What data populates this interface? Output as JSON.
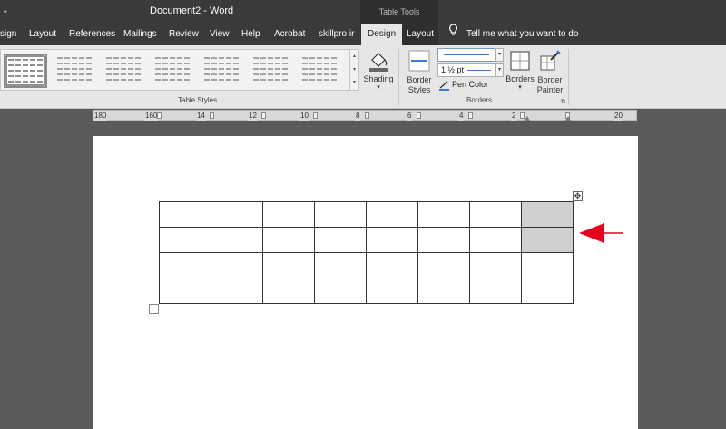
{
  "window": {
    "title": "Document2  -  Word",
    "context_header": "Table Tools",
    "qat_glyph": "⇣"
  },
  "tabs": [
    {
      "id": "design-doc",
      "label": "sign"
    },
    {
      "id": "layout",
      "label": "Layout"
    },
    {
      "id": "references",
      "label": "References"
    },
    {
      "id": "mailings",
      "label": "Mailings"
    },
    {
      "id": "review",
      "label": "Review"
    },
    {
      "id": "view",
      "label": "View"
    },
    {
      "id": "help",
      "label": "Help"
    },
    {
      "id": "acrobat",
      "label": "Acrobat"
    },
    {
      "id": "skillpro",
      "label": "skillpro.ir"
    },
    {
      "id": "table-design",
      "label": "Design",
      "active": true
    },
    {
      "id": "table-layout",
      "label": "Layout"
    }
  ],
  "tell_me": "Tell me what you want to do",
  "ribbon": {
    "table_styles_label": "Table Styles",
    "shading_label": "Shading",
    "border_styles_line1": "Border",
    "border_styles_line2": "Styles",
    "pen_weight": "1 ½ pt",
    "pen_color_label": "Pen Color",
    "borders_label": "Borders",
    "border_painter_line1": "Border",
    "border_painter_line2": "Painter",
    "borders_group_label": "Borders",
    "pen_color": "#3b7bd1",
    "dropdown_glyph": "▾",
    "gallery_up": "▴",
    "gallery_down": "▾",
    "gallery_more": "▾",
    "launcher_glyph": "⧉"
  },
  "ruler": {
    "labels": [
      "180",
      "160",
      "14",
      "12",
      "10",
      "8",
      "6",
      "4",
      "2",
      "20"
    ]
  },
  "document": {
    "table": {
      "rows": 4,
      "cols": 8,
      "shaded_cells": [
        [
          0,
          7
        ],
        [
          1,
          7
        ]
      ],
      "shade_color": "#d0d0d0"
    },
    "move_handle_glyph": "✥"
  },
  "annotation": {
    "arrow_color": "#e8001c"
  }
}
